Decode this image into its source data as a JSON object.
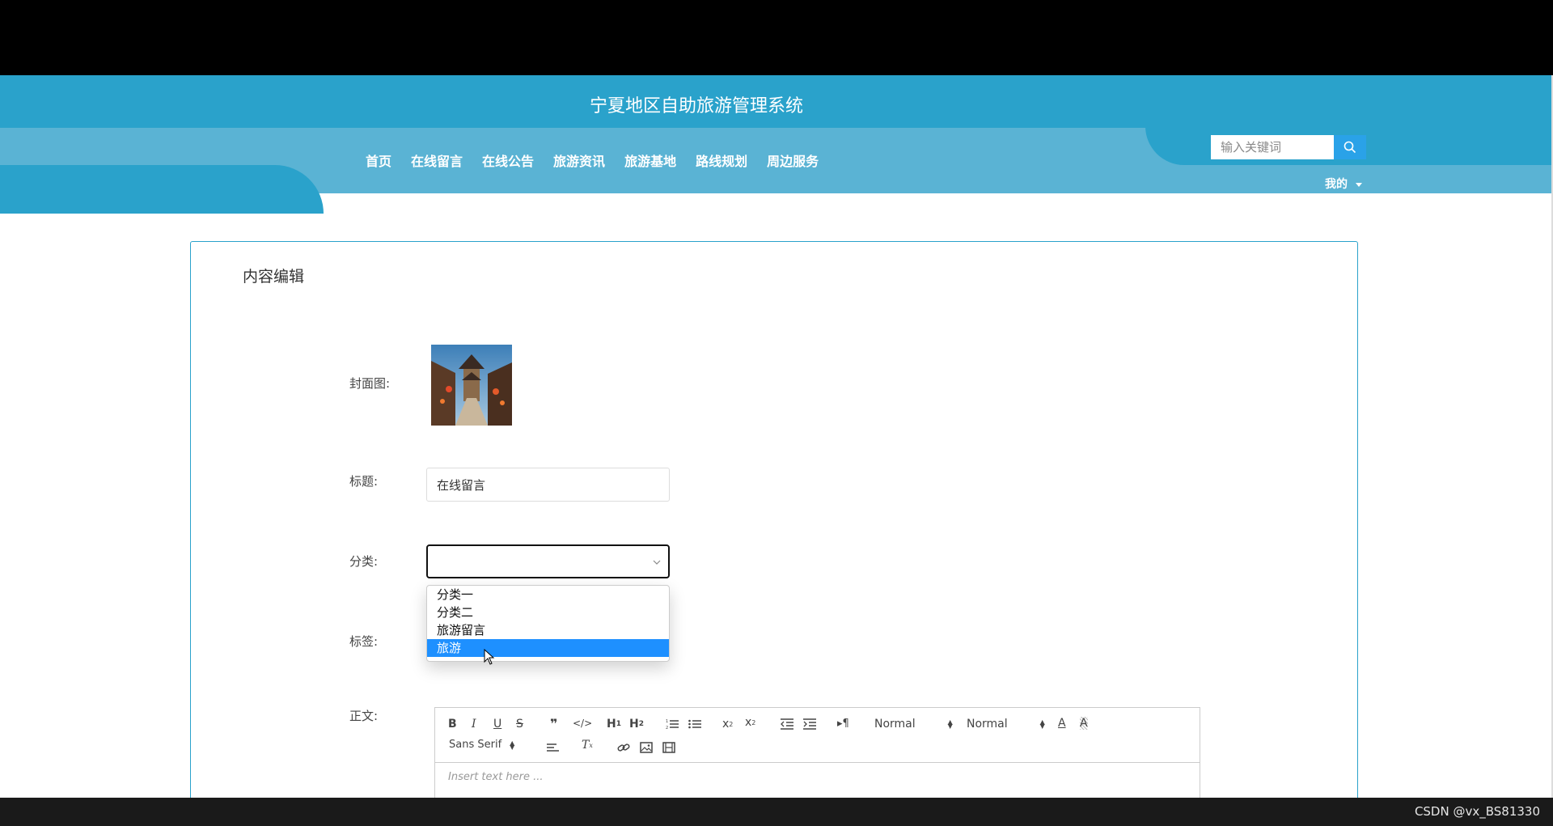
{
  "site": {
    "title": "宁夏地区自助旅游管理系统"
  },
  "nav": {
    "items": [
      "首页",
      "在线留言",
      "在线公告",
      "旅游资讯",
      "旅游基地",
      "路线规划",
      "周边服务"
    ],
    "search_placeholder": "输入关键词",
    "mine_label": "我的"
  },
  "form": {
    "heading": "内容编辑",
    "cover_label": "封面图:",
    "title_label": "标题:",
    "title_value": "在线留言",
    "category_label": "分类:",
    "category_options": [
      "分类一",
      "分类二",
      "旅游留言",
      "旅游"
    ],
    "category_highlighted": "旅游",
    "tags_label": "标签:",
    "body_label": "正文:"
  },
  "editor": {
    "header_picker": "Normal",
    "size_picker": "Normal",
    "font_picker": "Sans Serif",
    "placeholder": "Insert text here ..."
  },
  "colors": {
    "header": "#2aa2cb",
    "nav": "#5ab3d4",
    "accent": "#1e90ff"
  },
  "watermark": "CSDN @vx_BS81330"
}
